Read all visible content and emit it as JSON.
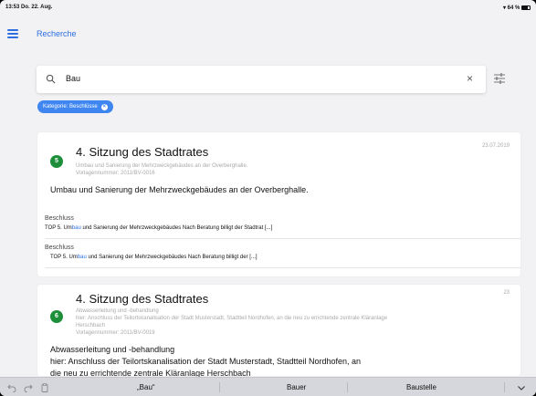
{
  "status_bar": {
    "time": "13:53",
    "date": "Do. 22. Aug.",
    "battery": "64 %"
  },
  "nav": {
    "title": "Recherche",
    "menu_icon": "hamburger-menu-icon"
  },
  "search": {
    "value": "Bau",
    "clear_icon": "close-icon",
    "filter_icon": "sliders-icon"
  },
  "filter_chip": {
    "label": "Kategorie: Beschlüsse"
  },
  "colors": {
    "accent": "#2d6fe0",
    "badge": "#1d8f3a",
    "chip": "#3f86f0"
  },
  "results": [
    {
      "badge": "5",
      "title": "4. Sitzung des Stadtrates",
      "date": "23.07.2019",
      "sub_line1": "Umbau und Sanierung der Mehrzweckgebäudes an der Overberghalle.",
      "sub_line2": "Vorlagennummer: 2011/BV-0016",
      "description": "Umbau und Sanierung der Mehrzweckgebäudes an der Overberghalle.",
      "highlights": [
        {
          "label": "Beschluss",
          "pre": "TOP 5. Um",
          "match": "bau",
          "post": " und Sanierung der Mehrzweckgebäudes   Nach Beratung billigt der Stadtrat  [...]"
        },
        {
          "label": "Beschluss",
          "pre": "TOP 5. Um",
          "match": "bau",
          "post": " und Sanierung der Mehrzweckgebäudes      Nach Beratung billigt der  [...]"
        }
      ]
    },
    {
      "badge": "6",
      "title": "4. Sitzung des Stadtrates",
      "date": "23",
      "sub_line1": "Abwasserleitung und -behandlung",
      "sub_line2": "hier: Anschluss der Teilortskanalisation der Stadt Musterstadt, Stadtteil Nordhofen, an die neu zu errichtende zentrale Kläranlage",
      "sub_line3": "Herschbach",
      "sub_line4": "Vorlagennummer: 2011/BV-0019",
      "description_line1": "Abwasserleitung und -behandlung",
      "description_line2": "hier: Anschluss der Teilortskanalisation der Stadt Musterstadt, Stadtteil Nordhofen, an",
      "description_line3": "die neu zu errichtende zentrale Kläranlage Herschbach"
    }
  ],
  "keyboard_bar": {
    "suggestions": [
      "„Bau“",
      "Bauer",
      "Baustelle"
    ],
    "undo_icon": "undo-icon",
    "redo_icon": "redo-icon",
    "clipboard_icon": "clipboard-icon",
    "dismiss_icon": "chevron-down-icon"
  }
}
